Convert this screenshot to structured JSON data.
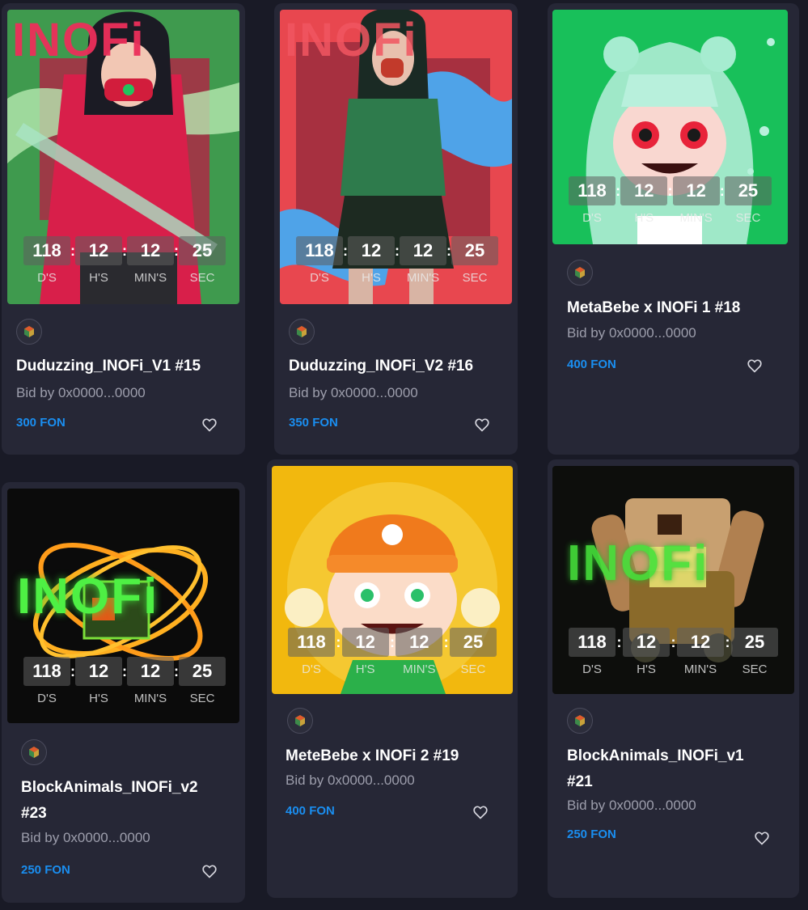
{
  "timer_labels": {
    "days": "D'S",
    "hours": "H'S",
    "minutes": "MIN'S",
    "seconds": "SEC"
  },
  "colors": {
    "price": "#1a8ef0",
    "card_bg": "#262736",
    "page_bg": "#191a26"
  },
  "cards": [
    {
      "title": "Duduzzing_INOFi_V1 #15",
      "bid": "Bid by 0x0000...0000",
      "price": "300 FON",
      "timer": {
        "days": "118",
        "hours": "12",
        "minutes": "12",
        "seconds": "25"
      },
      "art_text": "INOFi"
    },
    {
      "title": "Duduzzing_INOFi_V2 #16",
      "bid": "Bid by 0x0000...0000",
      "price": "350 FON",
      "timer": {
        "days": "118",
        "hours": "12",
        "minutes": "12",
        "seconds": "25"
      },
      "art_text": "INOFi"
    },
    {
      "title": "MetaBebe x INOFi 1 #18",
      "bid": "Bid by 0x0000...0000",
      "price": "400 FON",
      "timer": {
        "days": "118",
        "hours": "12",
        "minutes": "12",
        "seconds": "25"
      },
      "art_text": ""
    },
    {
      "title_line1": "BlockAnimals_INOFi_v2",
      "title_line2": "#23",
      "bid": "Bid by 0x0000...0000",
      "price": "250 FON",
      "timer": {
        "days": "118",
        "hours": "12",
        "minutes": "12",
        "seconds": "25"
      },
      "art_text": "INOFi"
    },
    {
      "title": "MeteBebe x INOFi 2 #19",
      "bid": "Bid by 0x0000...0000",
      "price": "400 FON",
      "timer": {
        "days": "118",
        "hours": "12",
        "minutes": "12",
        "seconds": "25"
      },
      "art_text": ""
    },
    {
      "title_line1": "BlockAnimals_INOFi_v1",
      "title_line2": "#21",
      "bid": "Bid by 0x0000...0000",
      "price": "250 FON",
      "timer": {
        "days": "118",
        "hours": "12",
        "minutes": "12",
        "seconds": "25"
      },
      "art_text": "INOFi"
    }
  ]
}
